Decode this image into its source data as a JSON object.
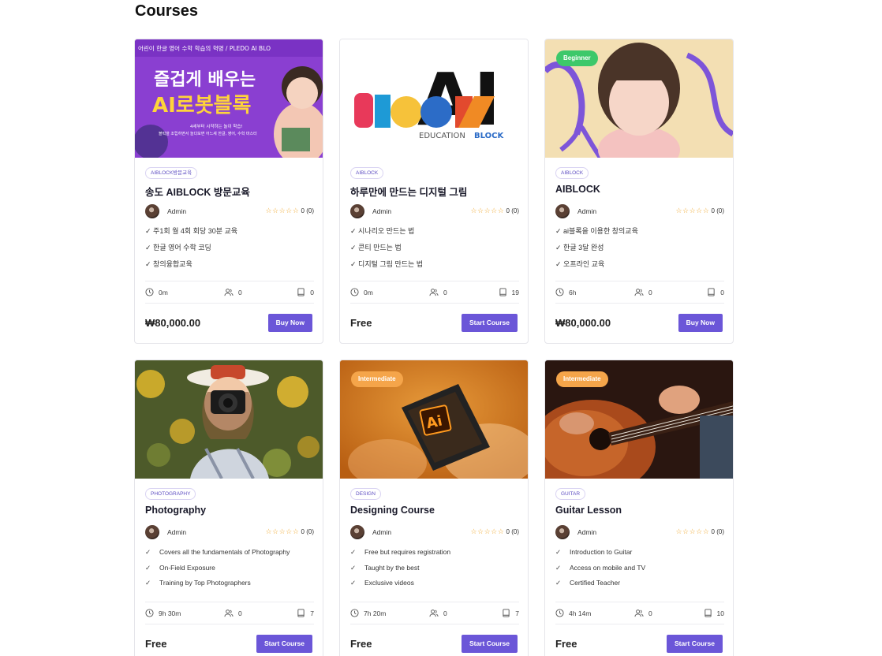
{
  "page_title": "Courses",
  "colors": {
    "accent": "#6b56d8",
    "star": "#f0a92f",
    "beginner": "#3dc86a",
    "intermediate": "#f5a54a"
  },
  "courses": [
    {
      "category": "AIBLOCK방문교육",
      "title": "송도 AIBLOCK 방문교육",
      "author": "Admin",
      "stars": "☆☆☆☆☆",
      "rating": "0 (0)",
      "features": [
        "✓ 주1회 월 4회 회당 30분 교육",
        "✓ 한글 영어 수학 코딩",
        "✓ 창의융합교육"
      ],
      "duration": "0m",
      "students": "0",
      "lessons": "0",
      "price": "₩80,000.00",
      "cta": "Buy Now",
      "thumb_text": {
        "top": "어린이 한글 영어 수학 학습의 혁명 / PLEDO AI BLO",
        "line1": "즐겁게 배우는",
        "line2": "AI로봇블록",
        "sub1": "4세부터 시작하는 놀이 학습!",
        "sub2": "블럭을 조립하면서 놀다보면 어느새 한글, 영어, 수학 마스터"
      }
    },
    {
      "category": "AIBLOCK",
      "title": "하루만에 만드는 디지털 그림",
      "author": "Admin",
      "stars": "☆☆☆☆☆",
      "rating": "0 (0)",
      "features": [
        "✓ 시나리오 만드는 법",
        "✓ 콘티 만드는 법",
        "✓ 디지털 그림 만드는 법"
      ],
      "duration": "0m",
      "students": "0",
      "lessons": "19",
      "price": "Free",
      "cta": "Start Course",
      "thumb_text": {
        "big": "AI",
        "block": "BLOCK",
        "edu": "EDUCATION",
        "edu_block": "BLOCK"
      }
    },
    {
      "category": "AIBLOCK",
      "title": "AIBLOCK",
      "level": "Beginner",
      "author": "Admin",
      "stars": "☆☆☆☆☆",
      "rating": "0 (0)",
      "features": [
        "✓ ai블록을 이용한 창의교육",
        "✓ 한글 3달 완성",
        "✓ 오프라인 교육"
      ],
      "duration": "6h",
      "students": "0",
      "lessons": "0",
      "price": "₩80,000.00",
      "cta": "Buy Now"
    },
    {
      "category": "PHOTOGRAPHY",
      "title": "Photography",
      "author": "Admin",
      "stars": "☆☆☆☆☆",
      "rating": "0 (0)",
      "features": [
        "Covers all the fundamentals of Photography",
        "On-Field Exposure",
        "Training by Top Photographers"
      ],
      "duration": "9h 30m",
      "students": "0",
      "lessons": "7",
      "price": "Free",
      "cta": "Start Course"
    },
    {
      "category": "DESIGN",
      "title": "Designing Course",
      "level": "Intermediate",
      "author": "Admin",
      "stars": "☆☆☆☆☆",
      "rating": "0 (0)",
      "features": [
        "Free but requires registration",
        "Taught by the best",
        "Exclusive videos"
      ],
      "duration": "7h 20m",
      "students": "0",
      "lessons": "7",
      "price": "Free",
      "cta": "Start Course",
      "thumb_text": {
        "app": "Ai"
      }
    },
    {
      "category": "GUITAR",
      "title": "Guitar Lesson",
      "level": "Intermediate",
      "author": "Admin",
      "stars": "☆☆☆☆☆",
      "rating": "0 (0)",
      "features": [
        "Introduction to Guitar",
        "Access on mobile and TV",
        "Certified Teacher"
      ],
      "duration": "4h 14m",
      "students": "0",
      "lessons": "10",
      "price": "Free",
      "cta": "Start Course"
    }
  ],
  "check_mark": "✓"
}
